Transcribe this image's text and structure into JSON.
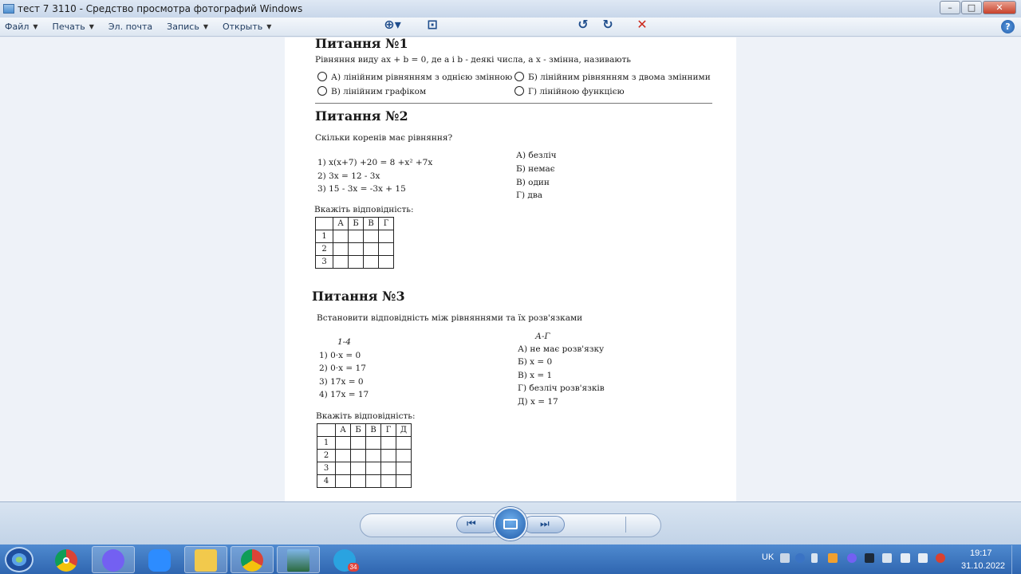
{
  "window": {
    "title": "тест 7 3110 - Средство просмотра фотографий Windows",
    "minimize": "–",
    "maximize": "□",
    "close": "✕"
  },
  "menu": {
    "file": "Файл",
    "print": "Печать",
    "email": "Эл. почта",
    "burn": "Запись",
    "open": "Открыть",
    "help": "?"
  },
  "doc": {
    "q1": {
      "title": "Питання №1",
      "prompt": "Рівняння виду ax + b = 0, де a і b - деякі числа, а x - змінна, називають",
      "opt_a": "А)  лінійним рівнянням з однією змінною",
      "opt_b": "Б)  лінійним рівнянням з двома змінними",
      "opt_v": "В)  лінійним графіком",
      "opt_g": "Г)  лінійною функцією"
    },
    "q2": {
      "title": "Питання №2",
      "prompt": "Скільки коренів має рівняння?",
      "eq1": "1)    x(x+7) +20 = 8 +x² +7x",
      "eq2": "2)    3x = 12 - 3x",
      "eq3": "3)    15 - 3x = -3x + 15",
      "ans_a": "А)    безліч",
      "ans_b": "Б)    немає",
      "ans_v": "В)    один",
      "ans_g": "Г)    два",
      "instruction": "Вкажіть відповідність:",
      "table_header": [
        "",
        "А",
        "Б",
        "В",
        "Г"
      ],
      "table_rows": [
        "1",
        "2",
        "3"
      ]
    },
    "q3": {
      "title": "Питання №3",
      "prompt": "Встановити відповідність між рівняннями та їх розв'язками",
      "left_head": "1-4",
      "right_head": "А-Г",
      "eq1": "1)    0·x = 0",
      "eq2": "2)    0·x = 17",
      "eq3": "3)    17x = 0",
      "eq4": "4)    17x = 17",
      "ans_a": "А)    не має розв'язку",
      "ans_b": "Б)    x = 0",
      "ans_v": "В)    x = 1",
      "ans_g": "Г)    безліч розв'язків",
      "ans_d": "Д)    x = 17",
      "instruction": "Вкажіть відповідність:",
      "table_header": [
        "",
        "А",
        "Б",
        "В",
        "Г",
        "Д"
      ],
      "table_rows": [
        "1",
        "2",
        "3",
        "4"
      ]
    }
  },
  "toolbar": {
    "zoom": "⊕▾",
    "actual_size": "⊡",
    "prev": "⏮",
    "next": "⏭",
    "rotate_ccw": "↺",
    "rotate_cw": "↻",
    "delete": "✕"
  },
  "taskbar": {
    "lang": "UK",
    "time": "19:17",
    "date": "31.10.2022",
    "telegram_badge": "34"
  },
  "icons": {
    "chrome": "chrome-icon",
    "viber": "viber-icon",
    "zoom": "zoom-icon",
    "explorer": "folder-icon",
    "chrome_profile": "chrome-profile-icon",
    "photo_viewer": "photo-viewer-icon",
    "telegram": "telegram-icon"
  }
}
